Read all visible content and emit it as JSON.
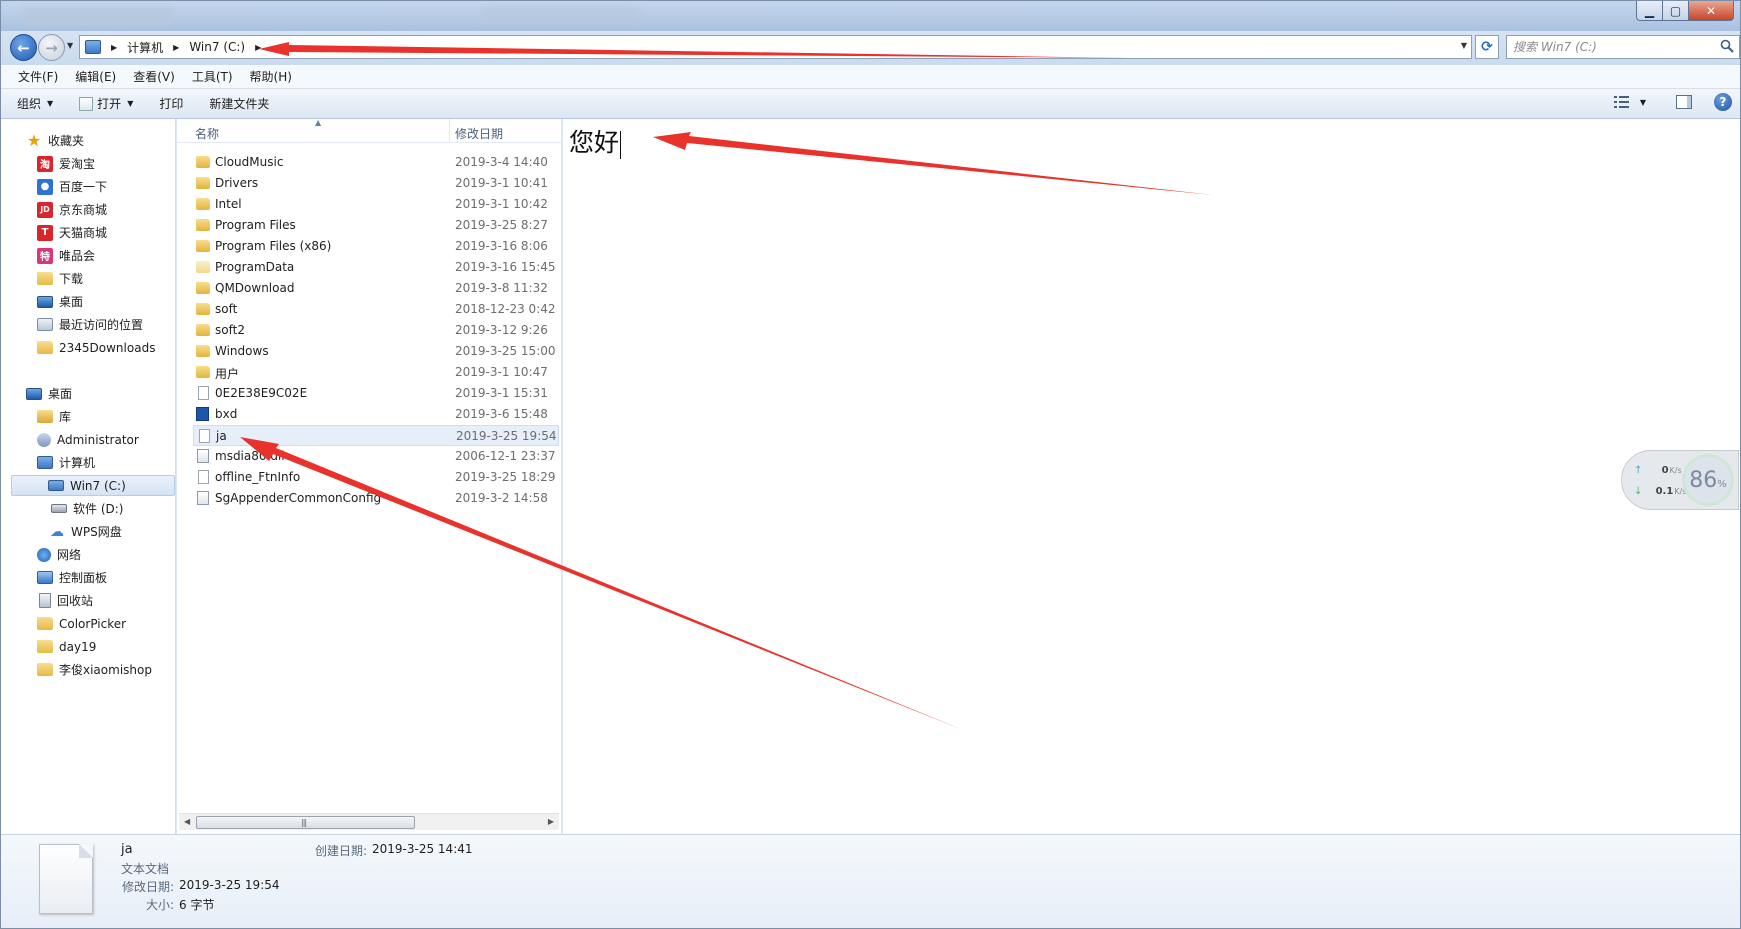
{
  "window": {
    "title": ""
  },
  "address_bar": {
    "segments": [
      "计算机",
      "Win7 (C:)"
    ],
    "search_placeholder": "搜索 Win7 (C:)"
  },
  "menu": [
    "文件(F)",
    "编辑(E)",
    "查看(V)",
    "工具(T)",
    "帮助(H)"
  ],
  "toolbar": {
    "organize": "组织",
    "open": "打开",
    "print": "打印",
    "new_folder": "新建文件夹"
  },
  "nav": {
    "favorites_header": "收藏夹",
    "favorites": [
      "爱淘宝",
      "百度一下",
      "京东商城",
      "天猫商城",
      "唯品会",
      "下载",
      "桌面",
      "最近访问的位置",
      "2345Downloads"
    ],
    "desktop_header": "桌面",
    "tree": [
      "库",
      "Administrator",
      "计算机",
      "Win7 (C:)",
      "软件 (D:)",
      "WPS网盘",
      "网络",
      "控制面板",
      "回收站",
      "ColorPicker",
      "day19",
      "李俊xiaomishop"
    ],
    "icon_glyphs": {
      "taobao": "淘",
      "jd": "JD",
      "tmall": "T",
      "vip": "特"
    }
  },
  "file_list": {
    "col_name": "名称",
    "col_date": "修改日期",
    "items": [
      {
        "name": "CloudMusic",
        "date": "2019-3-4 14:40",
        "icon": "folder"
      },
      {
        "name": "Drivers",
        "date": "2019-3-1 10:41",
        "icon": "folder"
      },
      {
        "name": "Intel",
        "date": "2019-3-1 10:42",
        "icon": "folder"
      },
      {
        "name": "Program Files",
        "date": "2019-3-25 8:27",
        "icon": "folder"
      },
      {
        "name": "Program Files (x86)",
        "date": "2019-3-16 8:06",
        "icon": "folder"
      },
      {
        "name": "ProgramData",
        "date": "2019-3-16 15:45",
        "icon": "folder-faded"
      },
      {
        "name": "QMDownload",
        "date": "2019-3-8 11:32",
        "icon": "folder"
      },
      {
        "name": "soft",
        "date": "2018-12-23 0:42",
        "icon": "folder"
      },
      {
        "name": "soft2",
        "date": "2019-3-12 9:26",
        "icon": "folder"
      },
      {
        "name": "Windows",
        "date": "2019-3-25 15:00",
        "icon": "folder"
      },
      {
        "name": "用户",
        "date": "2019-3-1 10:47",
        "icon": "folder"
      },
      {
        "name": "0E2E38E9C02E",
        "date": "2019-3-1 15:31",
        "icon": "doc"
      },
      {
        "name": "bxd",
        "date": "2019-3-6 15:48",
        "icon": "app"
      },
      {
        "name": "ja",
        "date": "2019-3-25 19:54",
        "icon": "doc",
        "selected": true
      },
      {
        "name": "msdia80.dll",
        "date": "2006-12-1 23:37",
        "icon": "dll"
      },
      {
        "name": "offline_FtnInfo",
        "date": "2019-3-25 18:29",
        "icon": "doc"
      },
      {
        "name": "SgAppenderCommonConfig",
        "date": "2019-3-2 14:58",
        "icon": "dll"
      }
    ]
  },
  "preview": {
    "text": "您好"
  },
  "speed_widget": {
    "up": "0",
    "down": "0.1",
    "unit": "K/s",
    "percent": "86",
    "percent_sign": "%"
  },
  "details": {
    "name": "ja",
    "type": "文本文档",
    "modified_label": "修改日期:",
    "modified": "2019-3-25 19:54",
    "size_label": "大小:",
    "size": "6 字节",
    "created_label": "创建日期:",
    "created": "2019-3-25 14:41"
  },
  "colors": {
    "accent": "#dbe7f4",
    "annotation_arrow": "#e8322b",
    "selection": "#e5eef9"
  }
}
